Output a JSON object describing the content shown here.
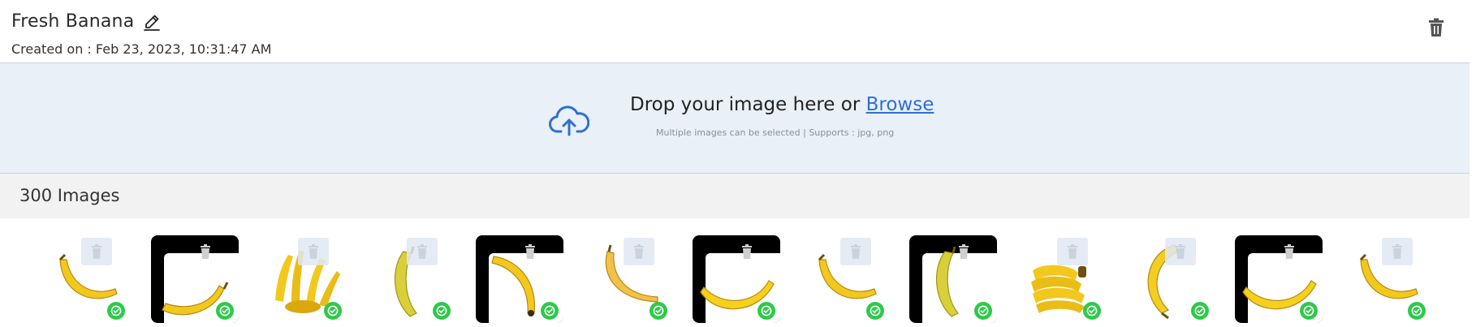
{
  "header": {
    "title": "Fresh Banana",
    "created_on": "Created on : Feb 23, 2023, 10:31:47 AM",
    "edit_icon": "pencil-icon",
    "delete_icon": "trash-icon"
  },
  "upload": {
    "prompt": "Drop your image here or ",
    "browse_label": "Browse",
    "hint": "Multiple images can be selected | Supports : jpg, png",
    "icon": "cloud-upload-icon"
  },
  "gallery": {
    "count_label": "300 Images",
    "status_icon": "check-circle-icon",
    "images": [
      {
        "variant": "single-curved",
        "framed": false,
        "selected": true
      },
      {
        "variant": "single-lying",
        "framed": true,
        "selected": true
      },
      {
        "variant": "bunch-open",
        "framed": false,
        "selected": true
      },
      {
        "variant": "single-standing",
        "framed": false,
        "selected": true
      },
      {
        "variant": "single-hooked",
        "framed": true,
        "selected": true
      },
      {
        "variant": "single-arched",
        "framed": false,
        "selected": true
      },
      {
        "variant": "single-flat",
        "framed": true,
        "selected": true
      },
      {
        "variant": "single-curved",
        "framed": false,
        "selected": true
      },
      {
        "variant": "single-standing",
        "framed": true,
        "selected": true
      },
      {
        "variant": "bunch-tight",
        "framed": false,
        "selected": true
      },
      {
        "variant": "single-crescent",
        "framed": false,
        "selected": true
      },
      {
        "variant": "single-flat",
        "framed": true,
        "selected": true
      },
      {
        "variant": "single-curved",
        "framed": false,
        "selected": true
      }
    ]
  },
  "colors": {
    "accent": "#2f6fd0",
    "dropzone_bg": "#e9f0f8",
    "success": "#2ec94a",
    "banana": "#f2c81e"
  }
}
